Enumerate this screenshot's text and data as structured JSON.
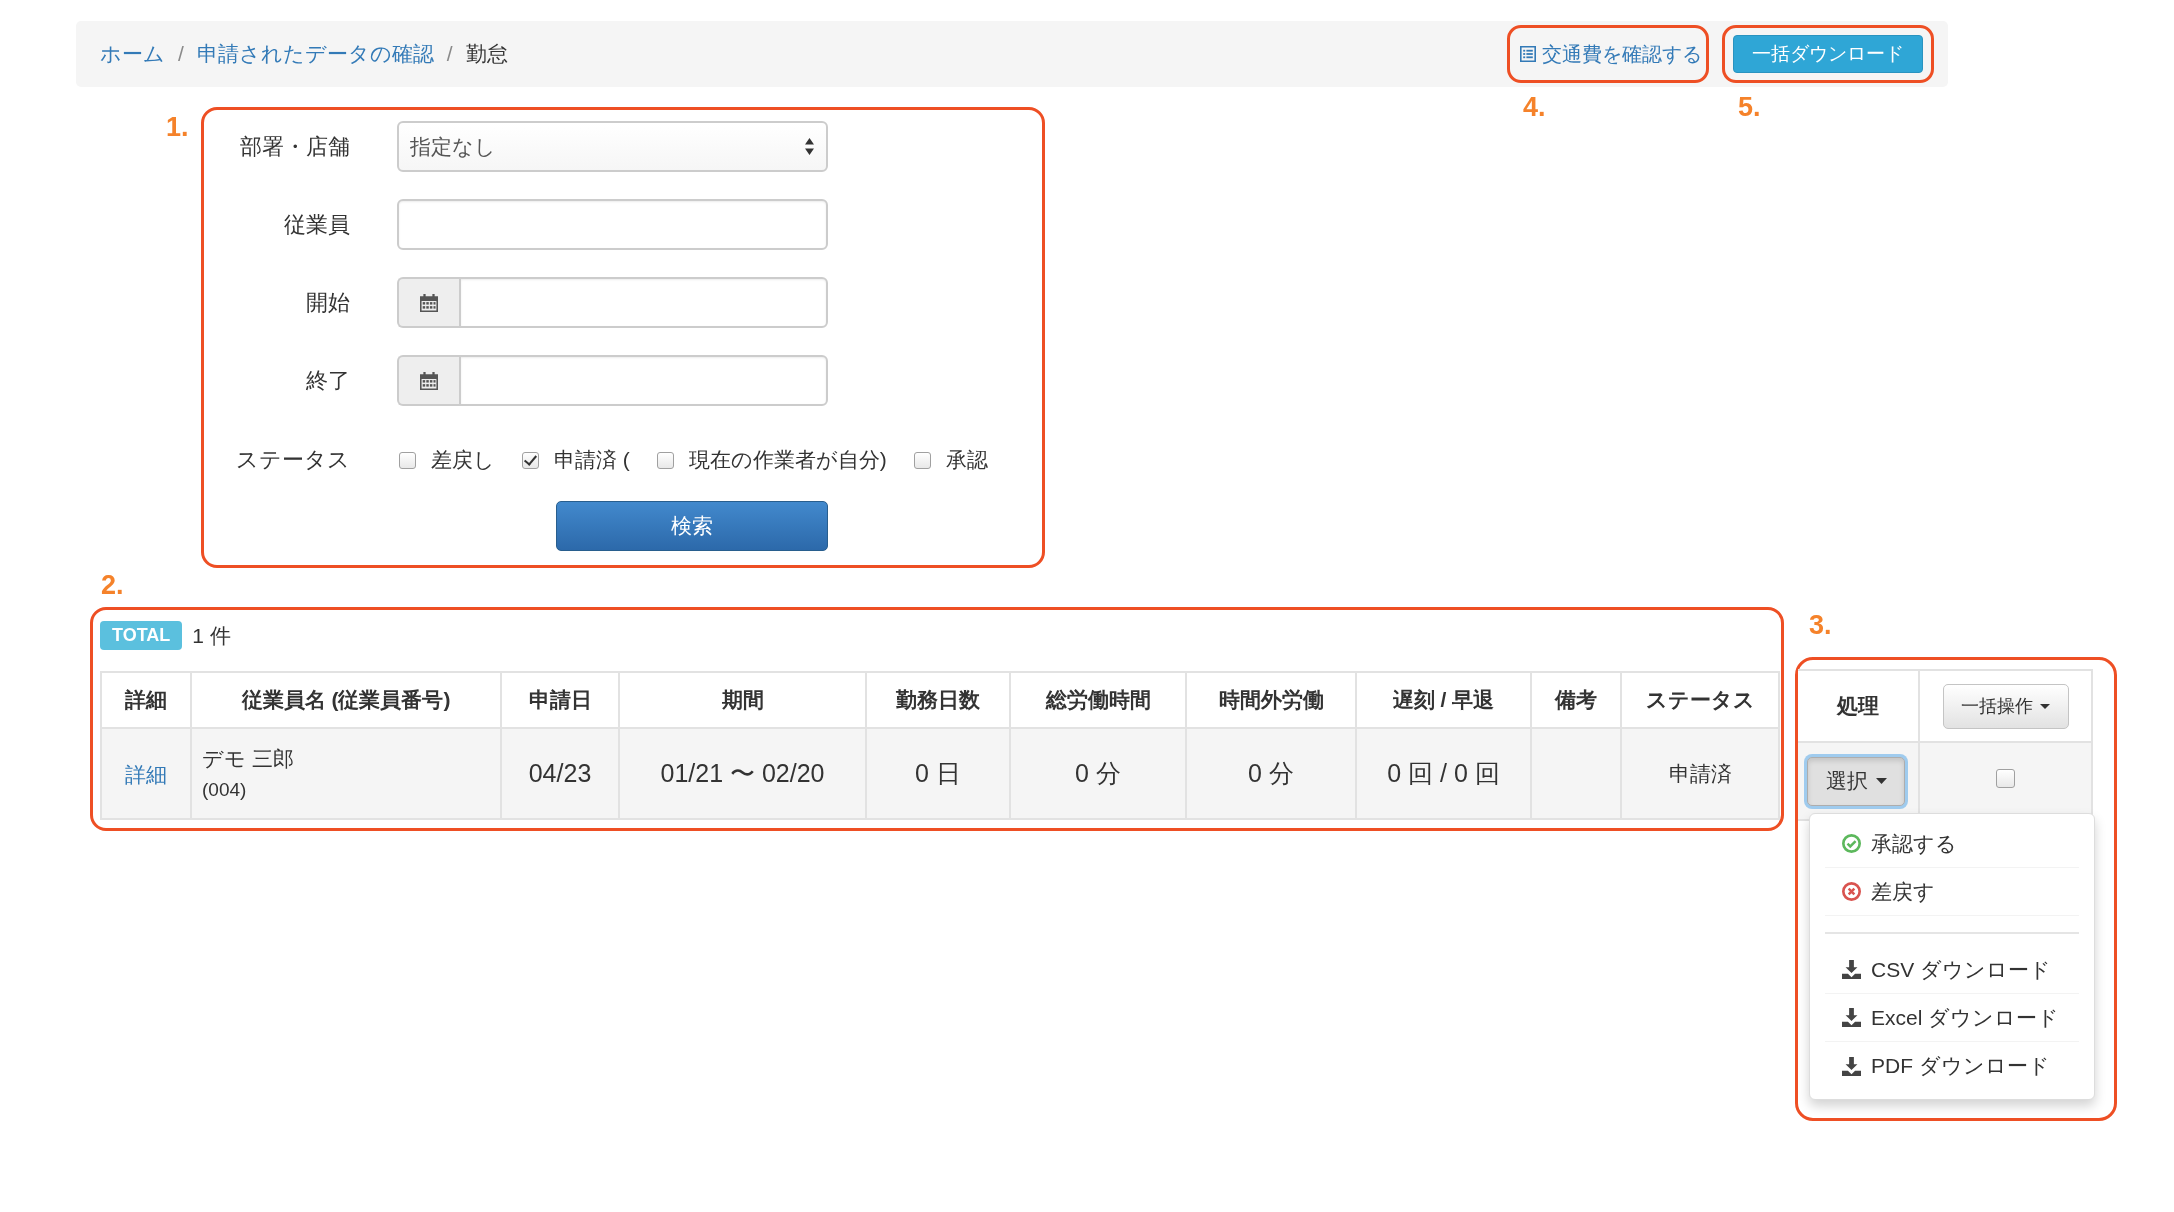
{
  "breadcrumb": [
    {
      "kind": "link",
      "label": "ホーム"
    },
    {
      "kind": "separator",
      "label": "/"
    },
    {
      "kind": "link",
      "label": "申請されたデータの確認"
    },
    {
      "kind": "separator",
      "label": "/"
    },
    {
      "kind": "current",
      "label": "勤怠"
    }
  ],
  "header_actions": [
    {
      "kind": "link",
      "label": "交通費を確認する",
      "callout": "4."
    },
    {
      "kind": "button",
      "label": "一括ダウンロード",
      "callout": "5."
    }
  ],
  "filter_form": {
    "callout": "1.",
    "fields": [
      {
        "kind": "select",
        "label": "部署・店舗",
        "value": "指定なし"
      },
      {
        "kind": "text",
        "label": "従業員"
      },
      {
        "kind": "date",
        "label": "開始"
      },
      {
        "kind": "date",
        "label": "終了"
      }
    ],
    "status": {
      "label": "ステータス",
      "options": [
        {
          "label": "差戻し",
          "checked": false
        },
        {
          "label": "申請済 (",
          "checked": true
        },
        {
          "label": "現在の作業者が自分)",
          "checked": false
        },
        {
          "label": "承認",
          "checked": false
        }
      ]
    },
    "submit": "検索"
  },
  "results": {
    "callout": "2.",
    "total_badge": "TOTAL",
    "total_count": "1 件",
    "columns": [
      "詳細",
      "従業員名 (従業員番号)",
      "申請日",
      "期間",
      "勤務日数",
      "総労働時間",
      "時間外労働",
      "遅刻 / 早退",
      "備考",
      "ステータス"
    ],
    "rows": [
      {
        "detail_link": "詳細",
        "employee_name": "デモ 三郎",
        "employee_number": "(004)",
        "applied_date": "04/23",
        "period": "01/21 〜 02/20",
        "work_days": "0 日",
        "total_work_time": "0 分",
        "overtime": "0 分",
        "late_early": "0 回 / 0 回",
        "status": "申請済"
      }
    ]
  },
  "actions_panel": {
    "callout": "3.",
    "process_header": "処理",
    "bulk_button": "一括操作",
    "rows": [
      {
        "select_button": "選択",
        "checked": false,
        "expanded": true,
        "menu": {
          "sections": [
            {
              "items": [
                {
                  "kind": "approve",
                  "label": "承認する"
                },
                {
                  "kind": "reject",
                  "label": "差戻す"
                }
              ]
            },
            {
              "items": [
                {
                  "kind": "download",
                  "label": "CSV ダウンロード"
                },
                {
                  "kind": "download",
                  "label": "Excel ダウンロード"
                },
                {
                  "kind": "download",
                  "label": "PDF ダウンロード"
                }
              ]
            }
          ]
        }
      }
    ]
  }
}
